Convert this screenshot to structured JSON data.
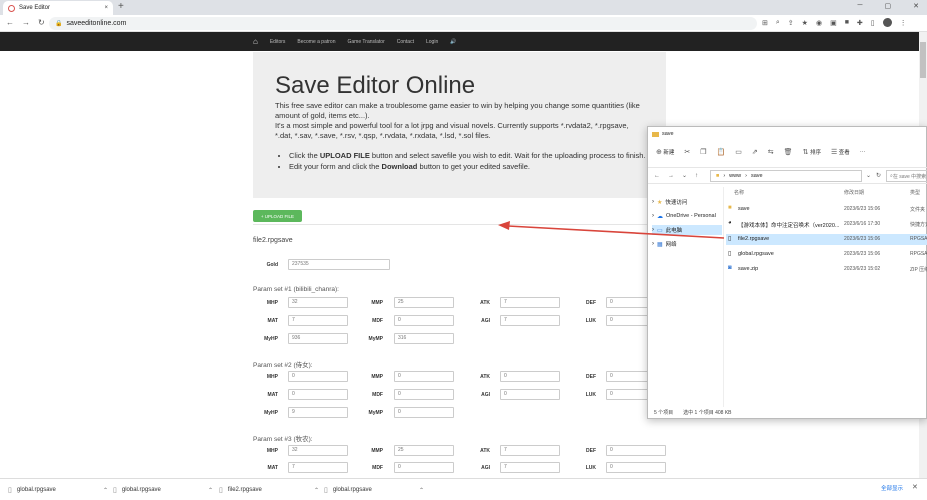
{
  "browser": {
    "tab_title": "Save Editor",
    "url": "saveeditonline.com",
    "tab_close": "×",
    "new_tab": "+",
    "win": {
      "min": "─",
      "max": "▢",
      "close": "✕"
    }
  },
  "nav": {
    "editors": "Editors",
    "parrot": "Become a patron",
    "translator": "Game Translator",
    "contact": "Contact",
    "login": "Login"
  },
  "hero": {
    "title": "Save Editor Online",
    "p1": "This free save editor can make a troublesome game easier to win by helping you change some quantities (like amount of gold, items etc...).",
    "p2": "It's a most simple and powerful tool for a lot jrpg and visual novels. Currently supports *.rvdata2, *.rpgsave, *.dat, *.sav, *.save, *.rsv, *.qsp, *.rvdata, *.rxdata, *.lsd, *.sol files.",
    "b1_pre": "Click the ",
    "b1_bold": "UPLOAD FILE",
    "b1_post": " button and select savefile you wish to edit. Wait for the uploading process to finish.",
    "b2_pre": "Edit your form and click the ",
    "b2_bold": "Download",
    "b2_post": " button to get your edited savefile."
  },
  "upload_label": "+ UPLOAD FILE",
  "file_name": "file2.rpgsave",
  "gold": {
    "label": "Gold",
    "value": "237535"
  },
  "sections": [
    "Param set #1 (bilibili_chanra):",
    "Param set #2 (侍女):",
    "Param set #3 (牧农):"
  ],
  "params": {
    "mhp": "MHP",
    "mmp": "MMP",
    "atk": "ATK",
    "def": "DEF",
    "mat": "MAT",
    "mdf": "MDF",
    "agi": "AGI",
    "luk": "LUK",
    "myhp": "MyHP",
    "mymp": "MyMP"
  },
  "set1": {
    "mhp": "32",
    "mmp": "25",
    "atk": "7",
    "def": "0",
    "mat": "7",
    "mdf": "0",
    "agi": "7",
    "luk": "0",
    "myhp": "936",
    "mymp": "316"
  },
  "set2": {
    "mhp": "0",
    "mmp": "0",
    "atk": "0",
    "def": "0",
    "mat": "0",
    "mdf": "0",
    "agi": "0",
    "luk": "0",
    "myhp": "9",
    "mymp": "0"
  },
  "set3": {
    "mhp": "32",
    "mmp": "25",
    "atk": "7",
    "def": "0",
    "mat": "7",
    "mdf": "0",
    "agi": "7",
    "luk": "0"
  },
  "explorer": {
    "title": "save",
    "new": "新建",
    "sort": "排序",
    "view": "查看",
    "more": "···",
    "path1": "www",
    "path2": "save",
    "search": "在 save 中搜索",
    "tree": [
      "快速访问",
      "OneDrive - Personal",
      "此电脑",
      "网络"
    ],
    "cols": {
      "name": "名称",
      "date": "修改日期",
      "type": "类型"
    },
    "files": [
      {
        "name": "save",
        "date": "2023/6/23 15:06",
        "type": "文件夹"
      },
      {
        "name": "【游戏本体】命中注定召唤术（ver2020...",
        "date": "2023/6/16 17:30",
        "type": "快捷方式"
      },
      {
        "name": "file2.rpgsave",
        "date": "2023/6/23 15:06",
        "type": "RPGSAVE"
      },
      {
        "name": "global.rpgsave",
        "date": "2023/6/23 15:06",
        "type": "RPGSAVE"
      },
      {
        "name": "save.zip",
        "date": "2023/6/23 15:02",
        "type": "ZIP 压缩"
      }
    ],
    "status_count": "5 个项目",
    "status_sel": "选中 1 个项目 408 KB"
  },
  "downloads": [
    "global.rpgsave",
    "global.rpgsave",
    "file2.rpgsave",
    "global.rpgsave"
  ],
  "show_all": "全部显示",
  "colors": {
    "upload_button": "#5cb85c",
    "navbar": "#222222",
    "arrow": "#d9453b"
  }
}
